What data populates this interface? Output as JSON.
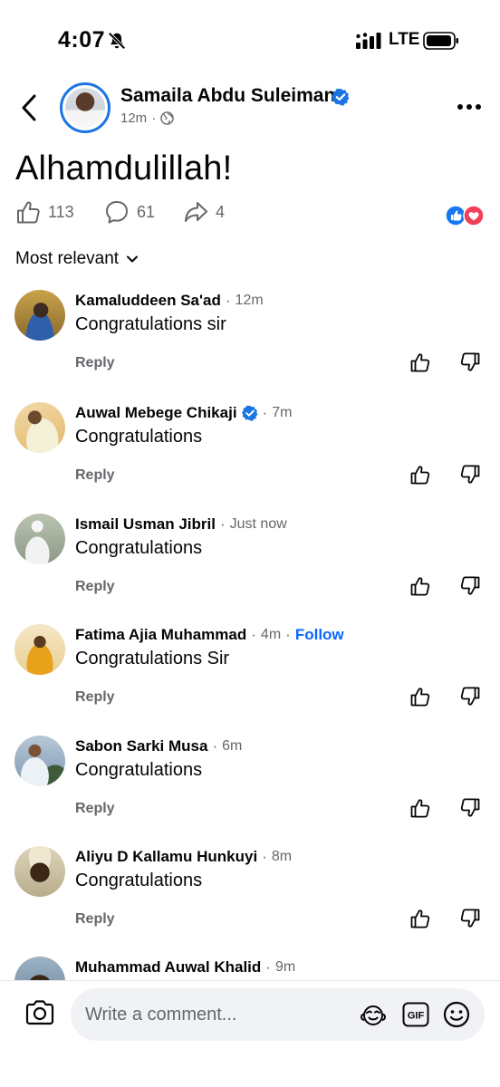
{
  "status_bar": {
    "time": "4:07",
    "network": "LTE",
    "icons": [
      "bell-off-icon",
      "signal-icon",
      "battery-icon"
    ]
  },
  "post": {
    "author": "Samaila Abdu Suleiman",
    "verified": true,
    "time": "12m",
    "audience_icon": "globe-icon",
    "text": "Alhamdulillah!",
    "likes": "113",
    "comments": "61",
    "shares": "4",
    "reactions": [
      "like",
      "love"
    ]
  },
  "sort_label": "Most relevant",
  "comments": [
    {
      "name": "Kamaluddeen Sa'ad",
      "verified": false,
      "time": "12m",
      "follow": "",
      "text": "Congratulations sir",
      "reply": "Reply"
    },
    {
      "name": "Auwal Mebege Chikaji",
      "verified": true,
      "time": "7m",
      "follow": "",
      "text": "Congratulations",
      "reply": "Reply"
    },
    {
      "name": "Ismail Usman Jibril",
      "verified": false,
      "time": "Just now",
      "follow": "",
      "text": "Congratulations",
      "reply": "Reply"
    },
    {
      "name": "Fatima Ajia Muhammad",
      "verified": false,
      "time": "4m",
      "follow": "Follow",
      "text": "Congratulations Sir",
      "reply": "Reply"
    },
    {
      "name": "Sabon Sarki Musa",
      "verified": false,
      "time": "6m",
      "follow": "",
      "text": "Congratulations",
      "reply": "Reply"
    },
    {
      "name": "Aliyu D Kallamu Hunkuyi",
      "verified": false,
      "time": "8m",
      "follow": "",
      "text": "Congratulations",
      "reply": "Reply"
    },
    {
      "name": "Muhammad Auwal Khalid",
      "verified": false,
      "time": "9m",
      "follow": "",
      "text": "",
      "reply": ""
    }
  ],
  "composer": {
    "placeholder": "Write a comment..."
  },
  "colors": {
    "accent": "#0866ff",
    "verified": "#1b74e4",
    "secondary_text": "#65676b",
    "love": "#f33e58"
  }
}
